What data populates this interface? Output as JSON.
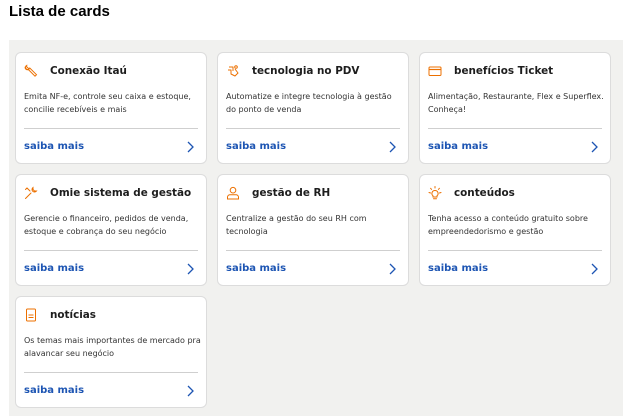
{
  "page": {
    "title": "Lista de cards"
  },
  "colors": {
    "accent": "#ec7000",
    "link": "#1d55b3"
  },
  "cards": [
    {
      "title": "Conexão Itaú",
      "icon": "wrench-icon",
      "description": "Emita NF-e, controle seu caixa e estoque, concilie recebíveis e mais",
      "link": "saiba mais"
    },
    {
      "title": "tecnologia no PDV",
      "icon": "tech-hand-icon",
      "description": "Automatize e integre tecnologia à gestão do ponto de venda",
      "link": "saiba mais"
    },
    {
      "title": "benefícios Ticket",
      "icon": "card-icon",
      "description": "Alimentação, Restaurante, Flex  e Superflex. Conheça!",
      "link": "saiba mais"
    },
    {
      "title": "Omie sistema de gestão",
      "icon": "tools-icon",
      "description": "Gerencie o financeiro, pedidos de venda, estoque e cobrança do seu negócio",
      "link": "saiba mais"
    },
    {
      "title": "gestão de RH",
      "icon": "person-icon",
      "description": "Centralize a gestão do seu RH com tecnologia",
      "link": "saiba mais"
    },
    {
      "title": "conteúdos",
      "icon": "lightbulb-icon",
      "description": "Tenha acesso a conteúdo gratuito sobre empreendedorismo e gestão",
      "link": "saiba mais"
    },
    {
      "title": "notícias",
      "icon": "document-icon",
      "description": "Os temas mais importantes de mercado pra alavancar seu negócio",
      "link": "saiba mais"
    }
  ]
}
